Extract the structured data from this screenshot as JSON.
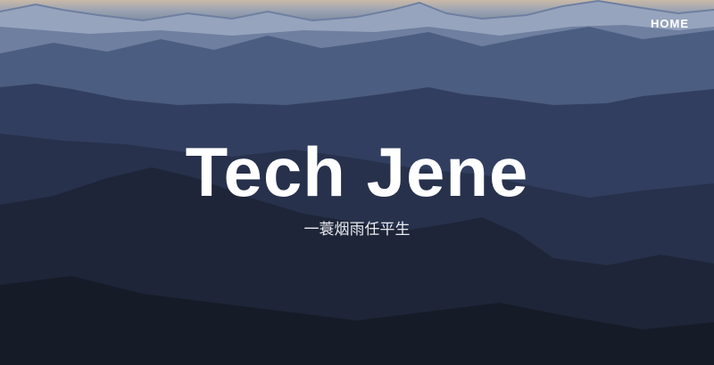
{
  "nav": {
    "home_label": "HOME"
  },
  "hero": {
    "title": "Tech Jene",
    "subtitle": "一蓑烟雨任平生"
  },
  "colors": {
    "text": "#ffffff",
    "sky_top": "#c9b9a8",
    "mountains_far": "#4b5d80",
    "mountains_mid": "#2c3858",
    "mountains_near": "#1a2033"
  }
}
